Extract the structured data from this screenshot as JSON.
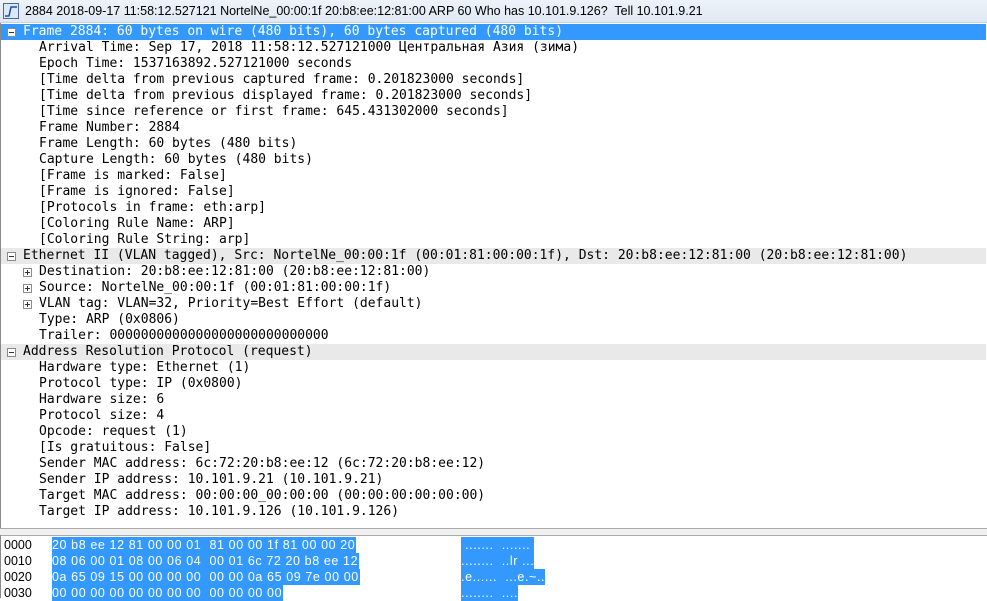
{
  "window": {
    "title": "2884 2018-09-17 11:58:12.527121 NortelNe_00:00:1f 20:b8:ee:12:81:00 ARP 60 Who has 10.101.9.126?  Tell 10.101.9.21"
  },
  "tree": [
    {
      "level": 0,
      "expander": "minus",
      "style": "sel",
      "text": "Frame 2884: 60 bytes on wire (480 bits), 60 bytes captured (480 bits)"
    },
    {
      "level": 1,
      "text": "Arrival Time: Sep 17, 2018 11:58:12.527121000 Центральная Азия (зима)"
    },
    {
      "level": 1,
      "text": "Epoch Time: 1537163892.527121000 seconds"
    },
    {
      "level": 1,
      "text": "[Time delta from previous captured frame: 0.201823000 seconds]"
    },
    {
      "level": 1,
      "text": "[Time delta from previous displayed frame: 0.201823000 seconds]"
    },
    {
      "level": 1,
      "text": "[Time since reference or first frame: 645.431302000 seconds]"
    },
    {
      "level": 1,
      "text": "Frame Number: 2884"
    },
    {
      "level": 1,
      "text": "Frame Length: 60 bytes (480 bits)"
    },
    {
      "level": 1,
      "text": "Capture Length: 60 bytes (480 bits)"
    },
    {
      "level": 1,
      "text": "[Frame is marked: False]"
    },
    {
      "level": 1,
      "text": "[Frame is ignored: False]"
    },
    {
      "level": 1,
      "text": "[Protocols in frame: eth:arp]"
    },
    {
      "level": 1,
      "text": "[Coloring Rule Name: ARP]"
    },
    {
      "level": 1,
      "text": "[Coloring Rule String: arp]"
    },
    {
      "level": 0,
      "expander": "minus",
      "style": "hdr",
      "text": "Ethernet II (VLAN tagged), Src: NortelNe_00:00:1f (00:01:81:00:00:1f), Dst: 20:b8:ee:12:81:00 (20:b8:ee:12:81:00)"
    },
    {
      "level": 1,
      "expander": "plus",
      "text": "Destination: 20:b8:ee:12:81:00 (20:b8:ee:12:81:00)"
    },
    {
      "level": 1,
      "expander": "plus",
      "text": "Source: NortelNe_00:00:1f (00:01:81:00:00:1f)"
    },
    {
      "level": 1,
      "expander": "plus",
      "text": "VLAN tag: VLAN=32, Priority=Best Effort (default)"
    },
    {
      "level": 1,
      "text": "Type: ARP (0x0806)"
    },
    {
      "level": 1,
      "text": "Trailer: 0000000000000000000000000000"
    },
    {
      "level": 0,
      "expander": "minus",
      "style": "hdr",
      "text": "Address Resolution Protocol (request)"
    },
    {
      "level": 1,
      "text": "Hardware type: Ethernet (1)"
    },
    {
      "level": 1,
      "text": "Protocol type: IP (0x0800)"
    },
    {
      "level": 1,
      "text": "Hardware size: 6"
    },
    {
      "level": 1,
      "text": "Protocol size: 4"
    },
    {
      "level": 1,
      "text": "Opcode: request (1)"
    },
    {
      "level": 1,
      "text": "[Is gratuitous: False]"
    },
    {
      "level": 1,
      "text": "Sender MAC address: 6c:72:20:b8:ee:12 (6c:72:20:b8:ee:12)"
    },
    {
      "level": 1,
      "text": "Sender IP address: 10.101.9.21 (10.101.9.21)"
    },
    {
      "level": 1,
      "text": "Target MAC address: 00:00:00_00:00:00 (00:00:00:00:00:00)"
    },
    {
      "level": 1,
      "text": "Target IP address: 10.101.9.126 (10.101.9.126)"
    }
  ],
  "hex": [
    {
      "offset": "0000",
      "bytes": "20 b8 ee 12 81 00 00 01  81 00 00 1f 81 00 00 20",
      "ascii": " .......  ....... "
    },
    {
      "offset": "0010",
      "bytes": "08 06 00 01 08 00 06 04  00 01 6c 72 20 b8 ee 12",
      "ascii": "........  ..lr ..."
    },
    {
      "offset": "0020",
      "bytes": "0a 65 09 15 00 00 00 00  00 00 0a 65 09 7e 00 00",
      "ascii": ".e......  ...e.~.."
    },
    {
      "offset": "0030",
      "bytes": "00 00 00 00 00 00 00 00  00 00 00 00",
      "ascii": "........  ...."
    }
  ]
}
